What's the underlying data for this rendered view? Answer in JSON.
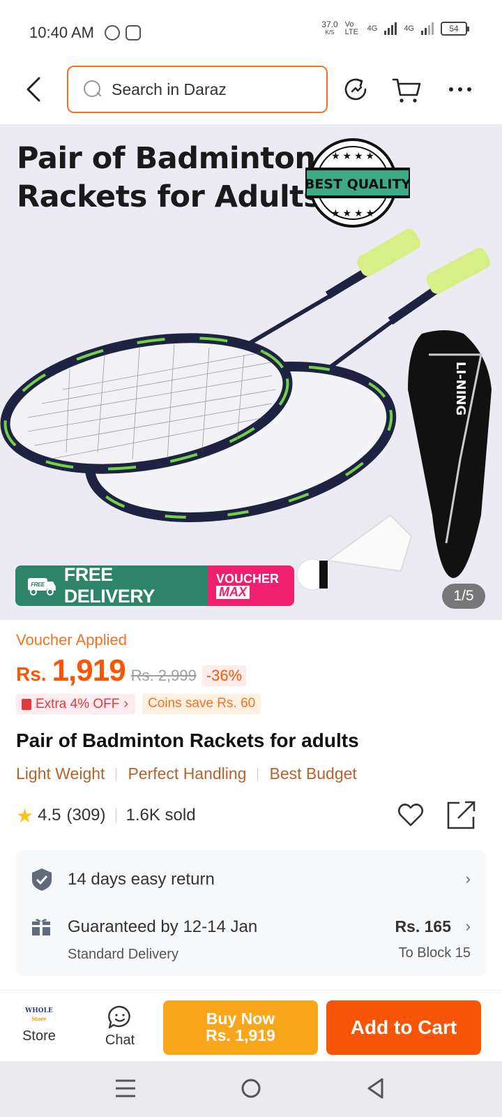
{
  "status_bar": {
    "time": "10:40 AM",
    "net_speed": "37.0",
    "net_unit": "K/S",
    "volte": "Vo LTE",
    "net1": "4G",
    "net2": "4G",
    "battery": "54"
  },
  "header": {
    "search_placeholder": "Search in Daraz"
  },
  "gallery": {
    "headline_line1": "Pair of Badminton",
    "headline_line2": "Rackets for Adults",
    "seal_text": "BEST QUALITY",
    "case_brand": "LI-NING",
    "free_label": "FREE",
    "free_delivery": "FREE DELIVERY",
    "voucher_line1": "VOUCHER",
    "voucher_line2": "MAX",
    "counter": "1/5"
  },
  "product": {
    "voucher_applied": "Voucher Applied",
    "currency": "Rs.",
    "price": "1,919",
    "old_price": "Rs. 2,999",
    "discount": "-36%",
    "extra_off": "Extra 4% OFF",
    "coins": "Coins save Rs. 60",
    "title": "Pair of Badminton Rackets for adults",
    "tags": [
      "Light Weight",
      "Perfect Handling",
      "Best Budget"
    ],
    "rating": "4.5",
    "reviews": "(309)",
    "sold": "1.6K sold"
  },
  "delivery": {
    "return_policy": "14 days easy return",
    "guarantee": "Guaranteed by 12-14 Jan",
    "method": "Standard Delivery",
    "fee": "Rs. 165",
    "destination": "To Block 15"
  },
  "bottom_bar": {
    "store_logo_line1": "WHOLE",
    "store_logo_line2": "Store",
    "store_label": "Store",
    "chat_label": "Chat",
    "buy_now_line1": "Buy Now",
    "buy_now_line2": "Rs. 1,919",
    "add_to_cart": "Add to Cart"
  },
  "colors": {
    "accent": "#f85606",
    "search_border": "#f57224",
    "buy_now": "#f9a61a",
    "free_delivery": "#2e8468",
    "voucher_max": "#f0206e",
    "star": "#fcc31b"
  }
}
